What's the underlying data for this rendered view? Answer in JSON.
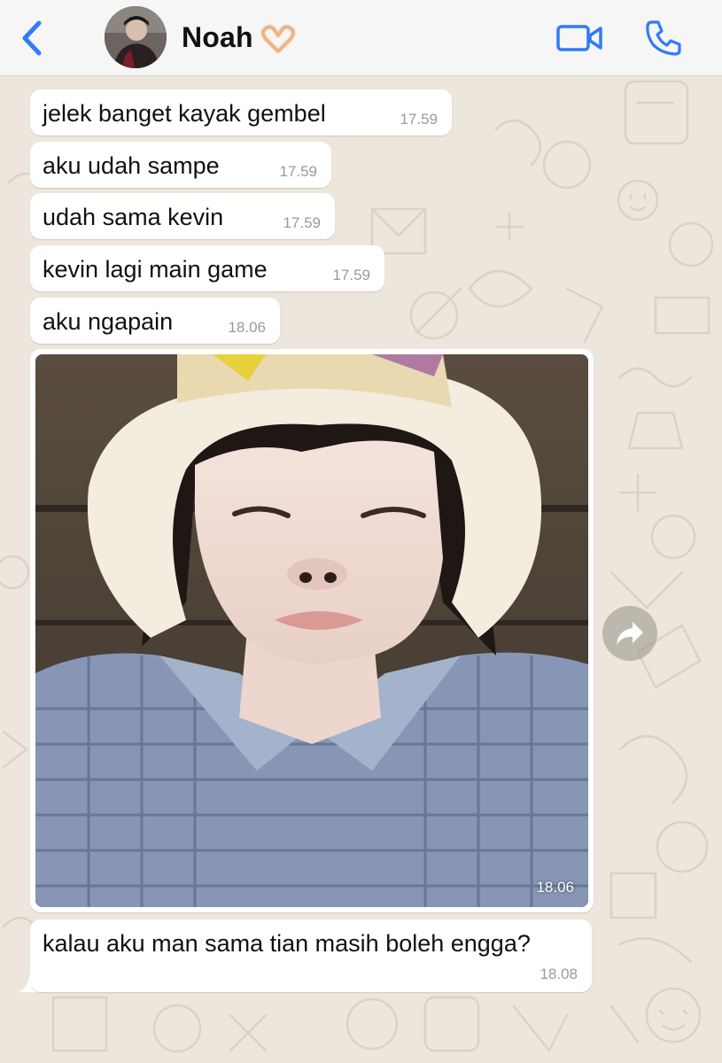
{
  "header": {
    "contact_name": "Noah",
    "name_emoji": "🫶🏻"
  },
  "messages": [
    {
      "text": "jelek banget kayak gembel",
      "time": "17.59"
    },
    {
      "text": "aku udah sampe",
      "time": "17.59"
    },
    {
      "text": "udah sama kevin",
      "time": "17.59"
    },
    {
      "text": "kevin lagi main game",
      "time": "17.59"
    },
    {
      "text": "aku ngapain",
      "time": "18.06"
    }
  ],
  "image_message": {
    "time": "18.06"
  },
  "last_message": {
    "text": "kalau aku man sama tian masih boleh engga?",
    "time": "18.08"
  },
  "colors": {
    "accent": "#2f7cf6",
    "chat_background": "#ece6dd",
    "bubble": "#ffffff",
    "header": "#f6f6f6"
  }
}
